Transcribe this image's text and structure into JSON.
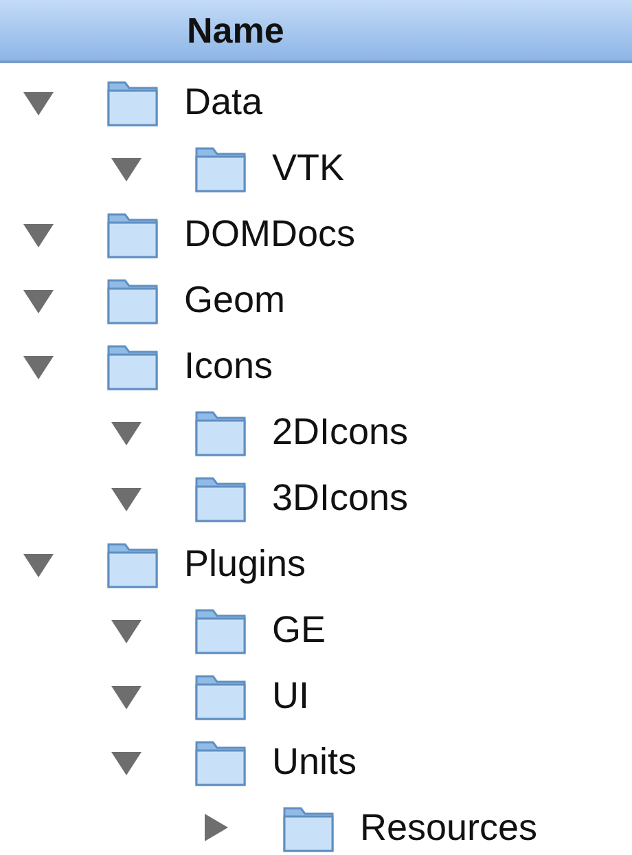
{
  "table": {
    "columns": [
      {
        "label": "Name",
        "selected": true
      }
    ]
  },
  "tree": [
    {
      "name": "Data",
      "expanded": true,
      "children": [
        {
          "name": "VTK",
          "expanded": true
        }
      ]
    },
    {
      "name": "DOMDocs",
      "expanded": true
    },
    {
      "name": "Geom",
      "expanded": true
    },
    {
      "name": "Icons",
      "expanded": true,
      "children": [
        {
          "name": "2DIcons",
          "expanded": true
        },
        {
          "name": "3DIcons",
          "expanded": true
        }
      ]
    },
    {
      "name": "Plugins",
      "expanded": true,
      "children": [
        {
          "name": "GE",
          "expanded": true
        },
        {
          "name": "UI",
          "expanded": true
        },
        {
          "name": "Units",
          "expanded": true,
          "children": [
            {
              "name": "Resources",
              "expanded": false
            }
          ]
        }
      ]
    }
  ]
}
